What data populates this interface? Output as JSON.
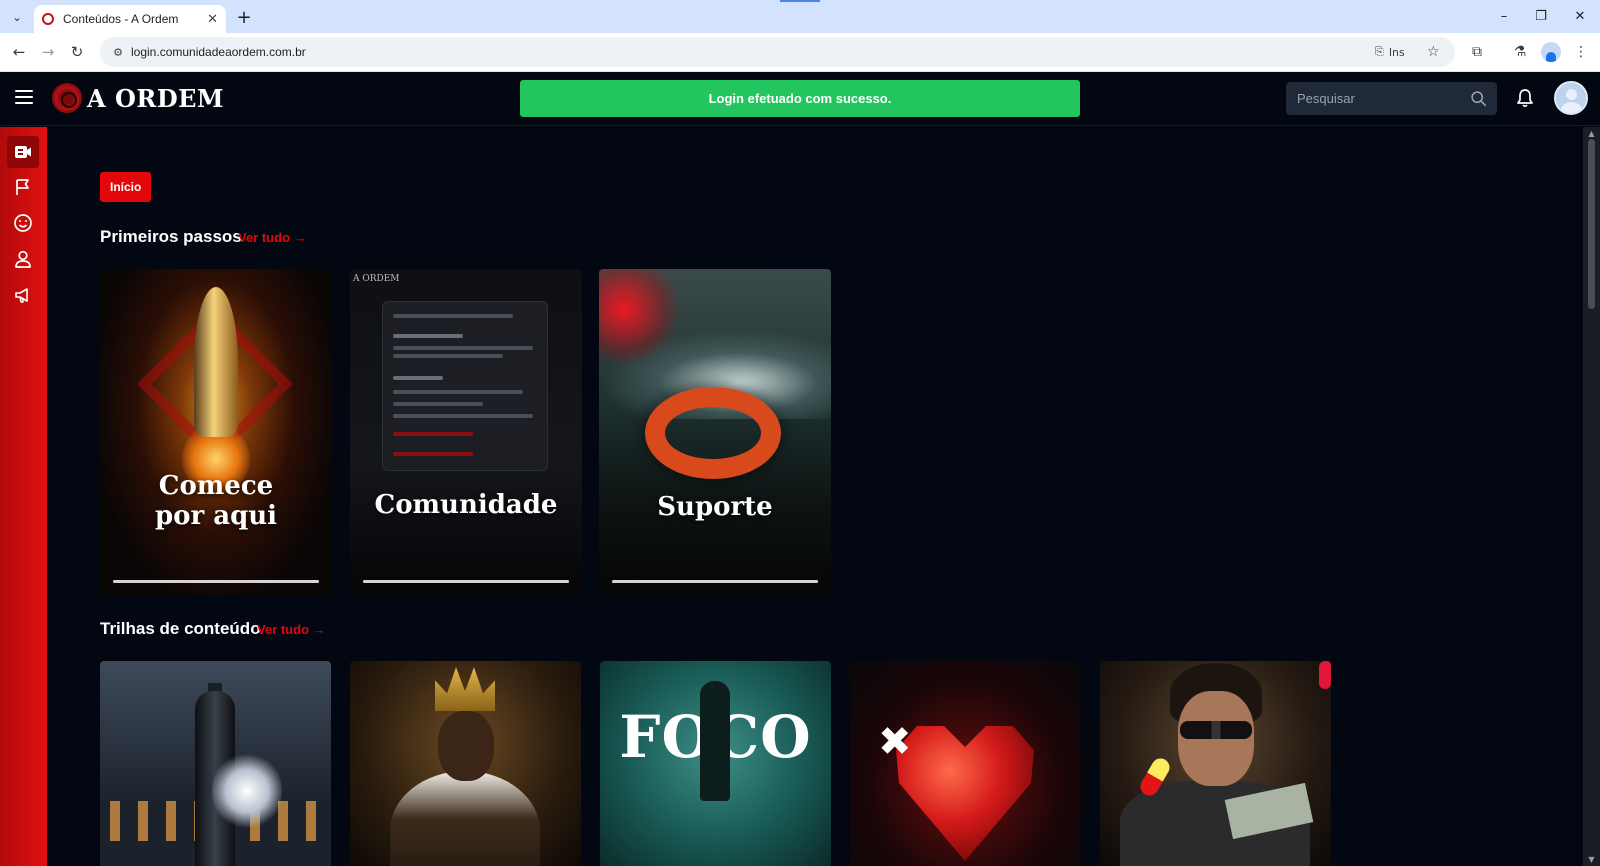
{
  "browser": {
    "tab_title": "Conteúdos - A Ordem",
    "url": "login.comunidadeaordem.com.br",
    "install_label": "Ins",
    "tab_dropdown_icon": "chevron-down-icon",
    "new_tab_icon": "plus-icon"
  },
  "header": {
    "logo_text": "A ORDEM",
    "toast": "Login efetuado com sucesso.",
    "search_placeholder": "Pesquisar"
  },
  "sidebar": {
    "items": [
      {
        "name": "contents",
        "icon": "video-icon",
        "active": true
      },
      {
        "name": "missions",
        "icon": "flag-icon",
        "active": false
      },
      {
        "name": "community",
        "icon": "smile-icon",
        "active": false
      },
      {
        "name": "profile",
        "icon": "user-icon",
        "active": false
      },
      {
        "name": "announcements",
        "icon": "megaphone-icon",
        "active": false
      }
    ]
  },
  "breadcrumb": "Início",
  "sections": [
    {
      "title": "Primeiros passos",
      "see_all": "Ver tudo →",
      "cards": [
        {
          "title_line1": "Comece",
          "title_line2": "por aqui",
          "progress": 1.0
        },
        {
          "title": "Comunidade",
          "progress": 1.0
        },
        {
          "title": "Suporte",
          "progress": 1.0
        }
      ]
    },
    {
      "title": "Trilhas de conteúdo",
      "see_all": "Ver tudo →",
      "thumbnails": [
        {
          "subject": "chess-king"
        },
        {
          "subject": "crowned-king"
        },
        {
          "subject": "foco",
          "text": "FOCO"
        },
        {
          "subject": "glass-heart"
        },
        {
          "subject": "man-with-sunglasses-money"
        }
      ]
    }
  ],
  "colors": {
    "accent_red": "#e3070b",
    "toast_green": "#22c55e",
    "background": "#030712"
  }
}
